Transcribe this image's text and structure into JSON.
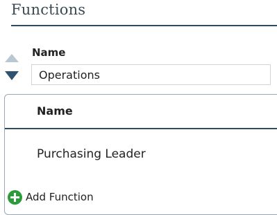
{
  "section": {
    "title": "Functions"
  },
  "name_field": {
    "label": "Name",
    "value": "Operations"
  },
  "sort": {
    "up_icon": "sort-up-icon",
    "down_icon": "sort-down-icon"
  },
  "grid": {
    "columns": [
      "Name"
    ],
    "rows": [
      {
        "name": "Purchasing Leader"
      }
    ],
    "add_button_label": "Add Function",
    "add_icon": "plus-circle-icon",
    "accent_color": "#2e4a5e",
    "add_icon_color": "#2e9b3b"
  }
}
